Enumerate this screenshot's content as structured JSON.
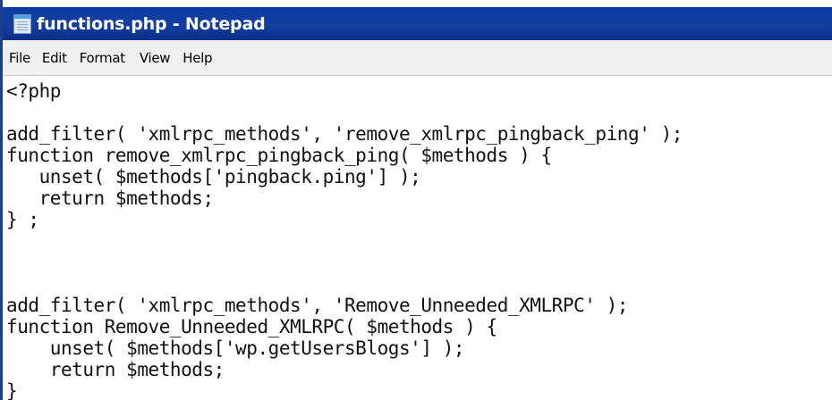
{
  "window": {
    "title": "functions.php - Notepad"
  },
  "menu": {
    "file": "File",
    "edit": "Edit",
    "format": "Format",
    "view": "View",
    "help": "Help"
  },
  "editor": {
    "lines": [
      "<?php",
      "",
      "add_filter( 'xmlrpc_methods', 'remove_xmlrpc_pingback_ping' );",
      "function remove_xmlrpc_pingback_ping( $methods ) {",
      "   unset( $methods['pingback.ping'] );",
      "   return $methods;",
      "} ;",
      "",
      "",
      "",
      "add_filter( 'xmlrpc_methods', 'Remove_Unneeded_XMLRPC' );",
      "function Remove_Unneeded_XMLRPC( $methods ) {",
      "    unset( $methods['wp.getUsersBlogs'] );",
      "    return $methods;",
      "}"
    ]
  },
  "icons": {
    "app": "notepad-icon"
  }
}
